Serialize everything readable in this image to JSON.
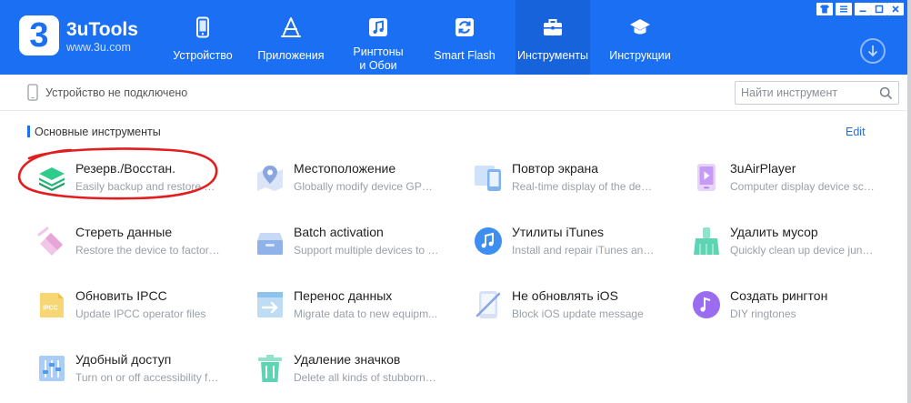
{
  "app": {
    "logo_char": "3",
    "name": "3uTools",
    "url": "www.3u.com"
  },
  "nav": [
    {
      "label": "Устройство",
      "icon": "phone-icon"
    },
    {
      "label": "Приложения",
      "icon": "app-store-icon"
    },
    {
      "label": "Рингтоны\nи Обои",
      "icon": "music-note-icon"
    },
    {
      "label": "Smart Flash",
      "icon": "refresh-icon"
    },
    {
      "label": "Инструменты",
      "icon": "toolbox-icon",
      "active": true
    },
    {
      "label": "Инструкции",
      "icon": "graduation-cap-icon"
    }
  ],
  "status": {
    "device": "Устройство не подключено"
  },
  "search": {
    "placeholder": "Найти инструмент"
  },
  "section": {
    "title": "Основные инструменты",
    "edit_label": "Edit"
  },
  "tools": [
    {
      "name": "Резерв./Восстан.",
      "desc": "Easily backup and restore de...",
      "icon": "backup-layers-icon",
      "color": "#2bb673"
    },
    {
      "name": "Местоположение",
      "desc": "Globally modify device GPS ...",
      "icon": "location-pin-icon",
      "color": "#8aa6e0"
    },
    {
      "name": "Повтор экрана",
      "desc": "Real-time display of the devi...",
      "icon": "screen-mirror-icon",
      "color": "#7fb4f0"
    },
    {
      "name": "3uAirPlayer",
      "desc": "Computer display device scr...",
      "icon": "airplayer-icon",
      "color": "#b57cf0"
    },
    {
      "name": "Стереть данные",
      "desc": "Restore the device to factory ...",
      "icon": "eraser-icon",
      "color": "#e7a6d8"
    },
    {
      "name": "Batch activation",
      "desc": "Support multiple devices to a...",
      "icon": "batch-box-icon",
      "color": "#7fa8e0"
    },
    {
      "name": "Утилиты iTunes",
      "desc": "Install and repair iTunes and ...",
      "icon": "itunes-icon",
      "color": "#3d8ef0"
    },
    {
      "name": "Удалить мусор",
      "desc": "Quickly clean up device junk ...",
      "icon": "broom-icon",
      "color": "#5fd4b4"
    },
    {
      "name": "Обновить IPCC",
      "desc": "Update IPCC operator files",
      "icon": "ipcc-file-icon",
      "color": "#f5c84a"
    },
    {
      "name": "Перенос данных",
      "desc": "Migrate data to new equipm...",
      "icon": "data-transfer-icon",
      "color": "#5fb0e8"
    },
    {
      "name": "Не обновлять iOS",
      "desc": "Block iOS update message",
      "icon": "block-update-icon",
      "color": "#8aa6e0"
    },
    {
      "name": "Создать рингтон",
      "desc": "DIY ringtones",
      "icon": "ringtone-icon",
      "color": "#9b6bf0"
    },
    {
      "name": "Удобный доступ",
      "desc": "Turn on or off accessibility fe...",
      "icon": "sliders-icon",
      "color": "#4f9af0"
    },
    {
      "name": "Удаление значков",
      "desc": "Delete all kinds of stubborn i...",
      "icon": "trash-icon",
      "color": "#5fd4b4"
    }
  ],
  "colors": {
    "header_bg": "#1a6ff2",
    "active_tab_bg": "#1763dc",
    "accent": "#1a6ff2",
    "annotation_red": "#e21d1d"
  }
}
